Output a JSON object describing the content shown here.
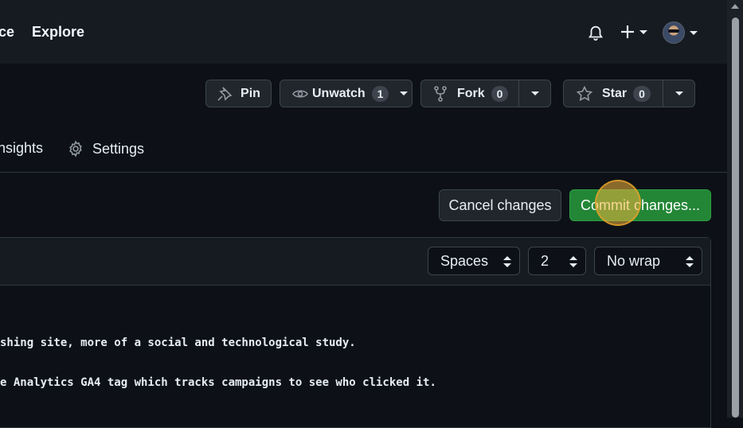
{
  "header": {
    "nav_partial": "ce",
    "explore": "Explore"
  },
  "repo_actions": {
    "pin": "Pin",
    "unwatch": "Unwatch",
    "unwatch_count": "1",
    "fork": "Fork",
    "fork_count": "0",
    "star": "Star",
    "star_count": "0"
  },
  "tabs": {
    "insights": "nsights",
    "settings": "Settings"
  },
  "actions": {
    "cancel": "Cancel changes",
    "commit": "Commit changes..."
  },
  "editor": {
    "indent_mode": "Spaces",
    "indent_size": "2",
    "wrap_mode": "No wrap",
    "lines": [
      "shing site, more of a social and technological study.",
      "e Analytics GA4 tag which tracks campaigns to see who clicked it."
    ]
  },
  "colors": {
    "page_bg": "#0d1117",
    "header_bg": "#161b22",
    "commit_green": "#238636",
    "border": "#30363d"
  }
}
